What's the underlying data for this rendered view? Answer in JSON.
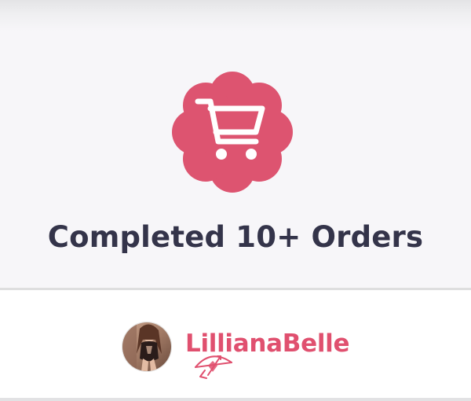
{
  "badge": {
    "icon": "shopping-cart-icon",
    "title": "Completed 10+ Orders",
    "accent_color": "#e0506f"
  },
  "profile": {
    "username": "LillianaBelle",
    "username_color": "#e0506f",
    "avatar_icon": "avatar-photo",
    "decoration_icon": "cupid-bow-arrow-icon"
  }
}
